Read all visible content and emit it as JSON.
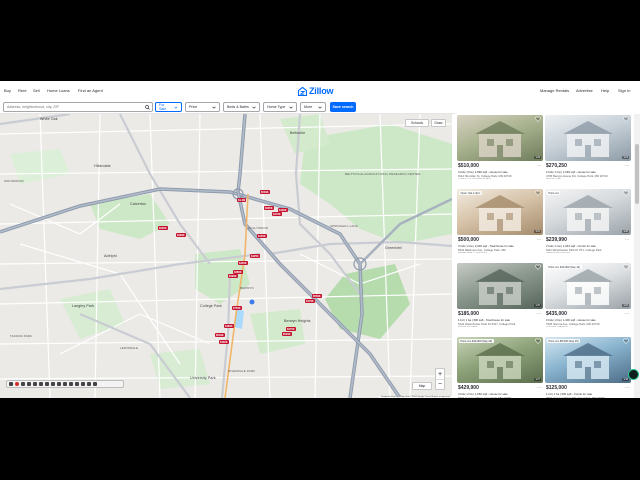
{
  "nav": {
    "left": [
      "Buy",
      "Rent",
      "Sell",
      "Home Loans",
      "Find an Agent"
    ],
    "right": [
      "Manage Rentals",
      "Advertise",
      "Help",
      "Sign In"
    ],
    "logo_text": "Zillow",
    "brand_color": "#006aff"
  },
  "search": {
    "placeholder": "Address, neighborhood, city, ZIP",
    "filters": [
      "For Sale",
      "Price",
      "Beds & Baths",
      "Home Type",
      "More"
    ],
    "save_label": "Save search"
  },
  "map": {
    "controls": {
      "schools": "Schools",
      "draw": "Draw",
      "map_type": "Map",
      "zoom_in": "+",
      "zoom_out": "−"
    },
    "labels": [
      "Beltsville",
      "Hillandale",
      "Calverton",
      "White Oak",
      "Adelphi",
      "Langley Park",
      "College Park",
      "Berwyn Heights",
      "Greenbelt",
      "University Park",
      "Riverdale Park",
      "Takoma Park",
      "Beltsville Agricultural Research Center",
      "Hollywood",
      "Berwyn",
      "Springhill Lake",
      "Lewisdale",
      "Woodmoor"
    ],
    "price_pins": [
      "$509K",
      "$1.3M",
      "$295K",
      "$430K",
      "$479K",
      "$200K",
      "$399K",
      "$150K",
      "$425K",
      "$435K",
      "$380K",
      "$299K",
      "$509K",
      "$479K",
      "$750K",
      "$480K",
      "$549K",
      "$400K",
      "$270K",
      "$529K"
    ],
    "footer": "Keyboard shortcuts   Map data ©2024 Google   Terms   Report a map error"
  },
  "listings": [
    {
      "price": "$510,000",
      "details": "4 bds | 3 ba | 1,890 sqft - House for sale",
      "address": "9114 Sheridan St, College Park, MD 20740",
      "broker": "LONG & FOSTER REAL ESTATE",
      "photos": "1/29"
    },
    {
      "price": "$270,250",
      "details": "2 bds | 1 ba | 1,049 sqft - House for sale",
      "address": "4706 Berwyn House Rd, College Park, MD 20740",
      "broker": "REDFIN CORP",
      "photos": "1/24"
    },
    {
      "price": "$500,000",
      "details": "3 bds | 2 ba | 2,000 sqft - Townhouse for sale",
      "address": "8432 Baltimore Ave, College Park, MD",
      "broker": "RE/MAX REALTY SERVICES",
      "badge": "Open: Sat 1-3pm",
      "photos": "1/31"
    },
    {
      "price": "$239,990",
      "details": "2 bds | 1 ba | 1,043 sqft - Condo for sale",
      "address": "6111 Westchester Park Dr #T1, College Park",
      "broker": "SAMSON PROPERTIES",
      "badge": "Price cut",
      "photos": "1/20"
    },
    {
      "price": "$185,000",
      "details": "1 bd | 1 ba | 690 sqft - Townhouse for sale",
      "address": "6122 Westchester Park Dr #317, College Park",
      "broker": "KELLER WILLIAMS",
      "photos": "1/15"
    },
    {
      "price": "$435,000",
      "details": "3 bds | 2 ba | 1,400 sqft - House for sale",
      "address": "7625 Glenna Ave, College Park, MD 20740",
      "broker": "COLDWELL BANKER",
      "badge": "Price cut: $10,000 (Sep 12)",
      "photos": "1/22"
    },
    {
      "price": "$429,900",
      "details": "4 bds | 2 ba | 1,650 sqft - House for sale",
      "address": "6904 Hanover Pkwy, Greenbelt, MD 20770",
      "broker": "EXP REALTY",
      "badge": "Price cut: $10,000 (Sep 22)",
      "photos": "1/27"
    },
    {
      "price": "$125,000",
      "details": "1 bd | 1 ba | 600 sqft - Condo for sale",
      "address": "7610 Hanover Pkwy #T1, Greenbelt, MD 20770",
      "broker": "CENTURY 21",
      "badge": "Price cut: $5,000 (Sep 20)",
      "photos": "1/18"
    },
    {
      "price": "",
      "details": "",
      "address": "",
      "broker": "",
      "badge": "Built in 1990s",
      "photos": ""
    },
    {
      "price": "",
      "details": "",
      "address": "",
      "broker": "",
      "badge": "Built in 2006",
      "photos": ""
    }
  ]
}
